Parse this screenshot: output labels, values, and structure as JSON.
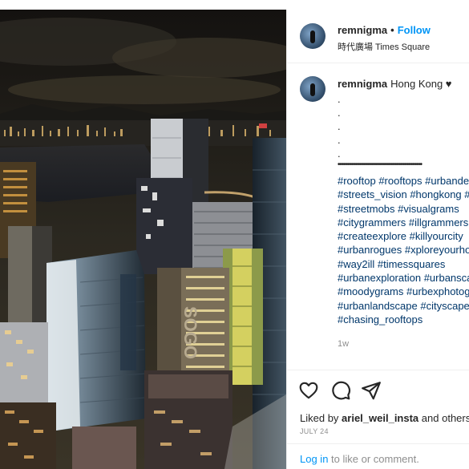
{
  "post": {
    "username": "remnigma",
    "separator": "•",
    "follow_label": "Follow",
    "location": "時代廣場 Times Square",
    "caption_text": "Hong Kong ♥",
    "caption_dots": [
      ".",
      ".",
      ".",
      ".",
      "."
    ],
    "divider_dots": "••••••••••••••••••••••••••••••••••••••••••",
    "hashtags": [
      "#rooftop #rooftops #urbandecay",
      "#streets_vision #hongkong #rooftopping",
      "#streetmobs #visualgrams",
      "#citygrammers #illgrammers",
      "#createexplore #killyourcity",
      "#urbanrogues #xploreyourhood",
      "#way2ill #timessquares",
      "#urbanexploration #urbanscape",
      "#moodygrams #urbexphotography",
      "#urbanlandscape #cityscape",
      "#chasing_rooftops"
    ],
    "time_ago": "1w",
    "liked_by_prefix": "Liked by",
    "liked_by_user": "ariel_weil_insta",
    "liked_by_suffix": "and others",
    "date": "JULY 24",
    "login_link": "Log in",
    "login_suffix": "to like or comment."
  },
  "icons": {
    "like": "heart-icon",
    "comment": "comment-icon",
    "share": "paper-plane-icon"
  },
  "colors": {
    "link_blue": "#0095f6",
    "hashtag": "#00376b",
    "muted": "#8e8e8e",
    "border": "#efefef"
  }
}
